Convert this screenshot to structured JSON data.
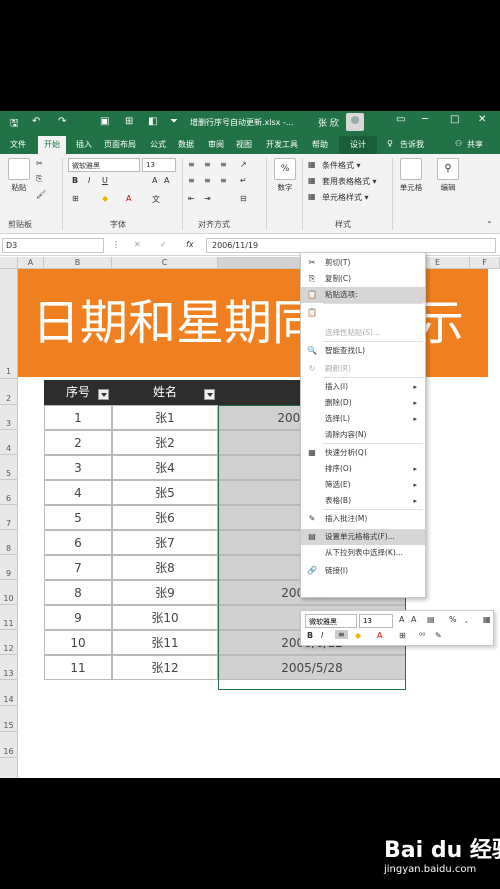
{
  "title_bar": {
    "document_title": "增删行序号自动更新.xlsx -...",
    "user_name": "张 欣",
    "window_controls": [
      "─",
      "□",
      "✕"
    ]
  },
  "tabs": [
    "文件",
    "开始",
    "插入",
    "页面布局",
    "公式",
    "数据",
    "审阅",
    "视图",
    "开发工具",
    "帮助",
    "设计"
  ],
  "tell_me": "告诉我",
  "share": "共享",
  "ribbon": {
    "paste": "粘贴",
    "font_name": "微软雅黑",
    "font_size": "13",
    "number_label": "数字",
    "styles": [
      "条件格式 ▾",
      "套用表格格式 ▾",
      "单元格样式 ▾"
    ],
    "cells": "单元格",
    "edit": "编辑",
    "groups": [
      "剪贴板",
      "字体",
      "对齐方式",
      "样式"
    ]
  },
  "formula_bar": {
    "name_box": "D3",
    "fx": "fx",
    "value": "2006/11/19"
  },
  "columns": [
    "A",
    "B",
    "C",
    "D",
    "E",
    "F"
  ],
  "rows": [
    "1",
    "2",
    "3",
    "4",
    "5",
    "6",
    "7",
    "8",
    "9",
    "10",
    "11",
    "12",
    "13",
    "14",
    "15",
    "16"
  ],
  "banner": "日期和星期同时显示",
  "table": {
    "headers": [
      "序号",
      "姓名",
      "出"
    ],
    "rows": [
      [
        "1",
        "张1",
        "2006/11/19"
      ],
      [
        "2",
        "张2",
        "20"
      ],
      [
        "3",
        "张4",
        "200"
      ],
      [
        "4",
        "张5",
        "200"
      ],
      [
        "5",
        "张6",
        "200"
      ],
      [
        "6",
        "张7",
        "200"
      ],
      [
        "7",
        "张8",
        "20"
      ],
      [
        "8",
        "张9",
        "2005/6/12"
      ],
      [
        "9",
        "张10",
        "200"
      ],
      [
        "10",
        "张11",
        "2006/6/12"
      ],
      [
        "11",
        "张12",
        "2005/5/28"
      ]
    ]
  },
  "context_menu": {
    "items": [
      {
        "label": "剪切(T)",
        "icon": "✂"
      },
      {
        "label": "复制(C)",
        "icon": "⎘"
      },
      {
        "label": "粘贴选项:",
        "icon": "📋"
      },
      {
        "label": "",
        "icon": "📋"
      },
      {
        "label": "选择性粘贴(S)...",
        "icon": ""
      },
      {
        "label": "智能查找(L)",
        "icon": "🔍"
      },
      {
        "label": "刷新(R)",
        "icon": "↻"
      },
      {
        "label": "插入(I)",
        "icon": ""
      },
      {
        "label": "删除(D)",
        "icon": ""
      },
      {
        "label": "选择(L)",
        "icon": ""
      },
      {
        "label": "清除内容(N)",
        "icon": ""
      },
      {
        "label": "快速分析(Q)",
        "icon": "▦"
      },
      {
        "label": "排序(O)",
        "icon": ""
      },
      {
        "label": "筛选(E)",
        "icon": ""
      },
      {
        "label": "表格(B)",
        "icon": ""
      },
      {
        "label": "插入批注(M)",
        "icon": "✎"
      },
      {
        "label": "设置单元格格式(F)...",
        "icon": "▤"
      },
      {
        "label": "从下拉列表中选择(K)...",
        "icon": ""
      },
      {
        "label": "链接(I)",
        "icon": "🔗"
      }
    ]
  },
  "mini_toolbar": {
    "font_name": "微软雅黑",
    "font_size": "13",
    "percent": "%"
  },
  "watermark": {
    "brand": "Bai du 经验",
    "url": "jingyan.baidu.com"
  }
}
